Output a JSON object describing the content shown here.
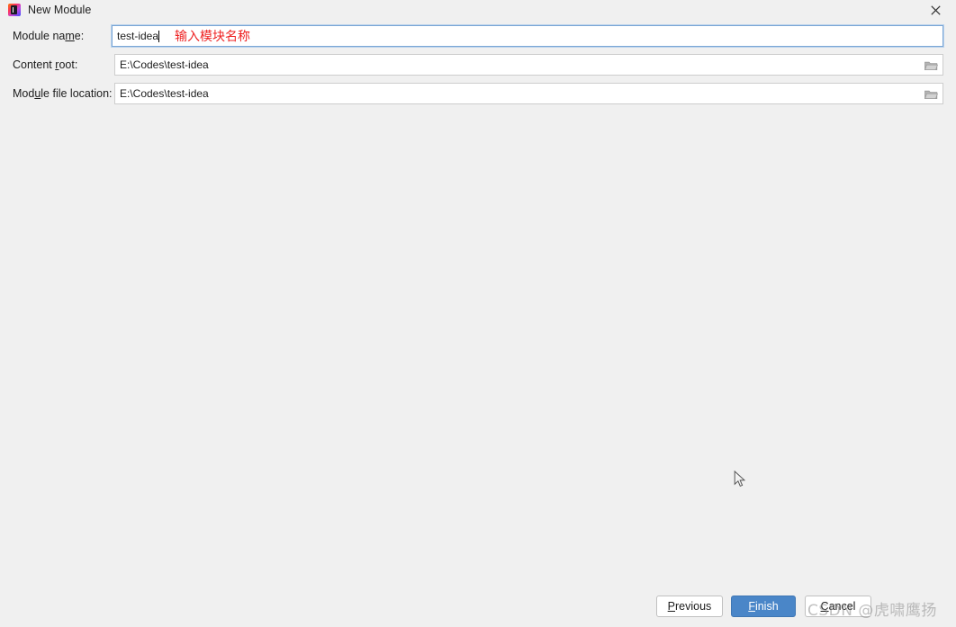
{
  "window": {
    "title": "New Module",
    "icon": "intellij-idea-logo",
    "close_label": "✕"
  },
  "form": {
    "rows": [
      {
        "label_before": "Module na",
        "label_mnemonic": "m",
        "label_after": "e:",
        "value": "test-idea",
        "focused": true,
        "has_browse": false,
        "annotation": "输入模块名称"
      },
      {
        "label_before": "Content ",
        "label_mnemonic": "r",
        "label_after": "oot:",
        "value": "E:\\Codes\\test-idea",
        "focused": false,
        "has_browse": true,
        "annotation": ""
      },
      {
        "label_before": "Mod",
        "label_mnemonic": "u",
        "label_after": "le file location:",
        "value": "E:\\Codes\\test-idea",
        "focused": false,
        "has_browse": true,
        "annotation": ""
      }
    ]
  },
  "footer": {
    "previous_before": "",
    "previous_mnemonic": "P",
    "previous_after": "revious",
    "finish_before": "",
    "finish_mnemonic": "F",
    "finish_after": "inish",
    "cancel_before": "",
    "cancel_mnemonic": "C",
    "cancel_after": "ancel"
  },
  "watermark": {
    "text": "CSDN @虎啸鹰扬"
  },
  "colors": {
    "dialog_bg": "#f0f0f0",
    "field_bg": "#ffffff",
    "focus_border": "#7aa6d6",
    "finish_bg": "#4a86c8",
    "annotation_red": "#ee2222",
    "text": "#1c1c1c"
  }
}
